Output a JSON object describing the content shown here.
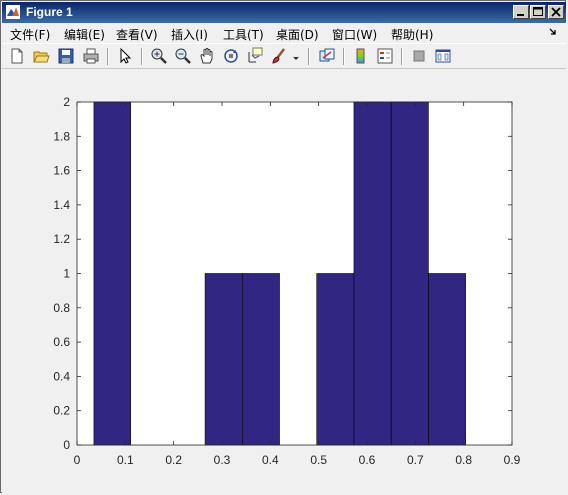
{
  "window": {
    "title": "Figure 1"
  },
  "menu": [
    {
      "label": "文件(F)"
    },
    {
      "label": "编辑(E)"
    },
    {
      "label": "查看(V)"
    },
    {
      "label": "插入(I)"
    },
    {
      "label": "工具(T)"
    },
    {
      "label": "桌面(D)"
    },
    {
      "label": "窗口(W)"
    },
    {
      "label": "帮助(H)"
    }
  ],
  "toolbar": {
    "buttons": [
      "new-figure-icon",
      "open-file-icon",
      "save-icon",
      "print-icon",
      "select-arrow-icon",
      "zoom-in-icon",
      "zoom-out-icon",
      "pan-hand-icon",
      "rotate-3d-icon",
      "data-cursor-icon",
      "brush-icon",
      "brush-dropdown-icon",
      "link-plot-icon",
      "colorbar-icon",
      "legend-icon",
      "hide-plot-tools-icon",
      "show-plot-tools-icon"
    ]
  },
  "chart_data": {
    "type": "bar",
    "bar_color": "#312783",
    "bin_edges": [
      0.035,
      0.111,
      0.188,
      0.265,
      0.342,
      0.419,
      0.496,
      0.573,
      0.65,
      0.727,
      0.804
    ],
    "values": [
      2,
      0,
      0,
      1,
      1,
      0,
      1,
      2,
      2,
      1
    ],
    "xlim": [
      0,
      0.9
    ],
    "ylim": [
      0,
      2
    ],
    "xticks": [
      "0",
      "0.1",
      "0.2",
      "0.3",
      "0.4",
      "0.5",
      "0.6",
      "0.7",
      "0.8",
      "0.9"
    ],
    "yticks": [
      "0",
      "0.2",
      "0.4",
      "0.6",
      "0.8",
      "1",
      "1.2",
      "1.4",
      "1.6",
      "1.8",
      "2"
    ],
    "title": "",
    "xlabel": "",
    "ylabel": ""
  }
}
